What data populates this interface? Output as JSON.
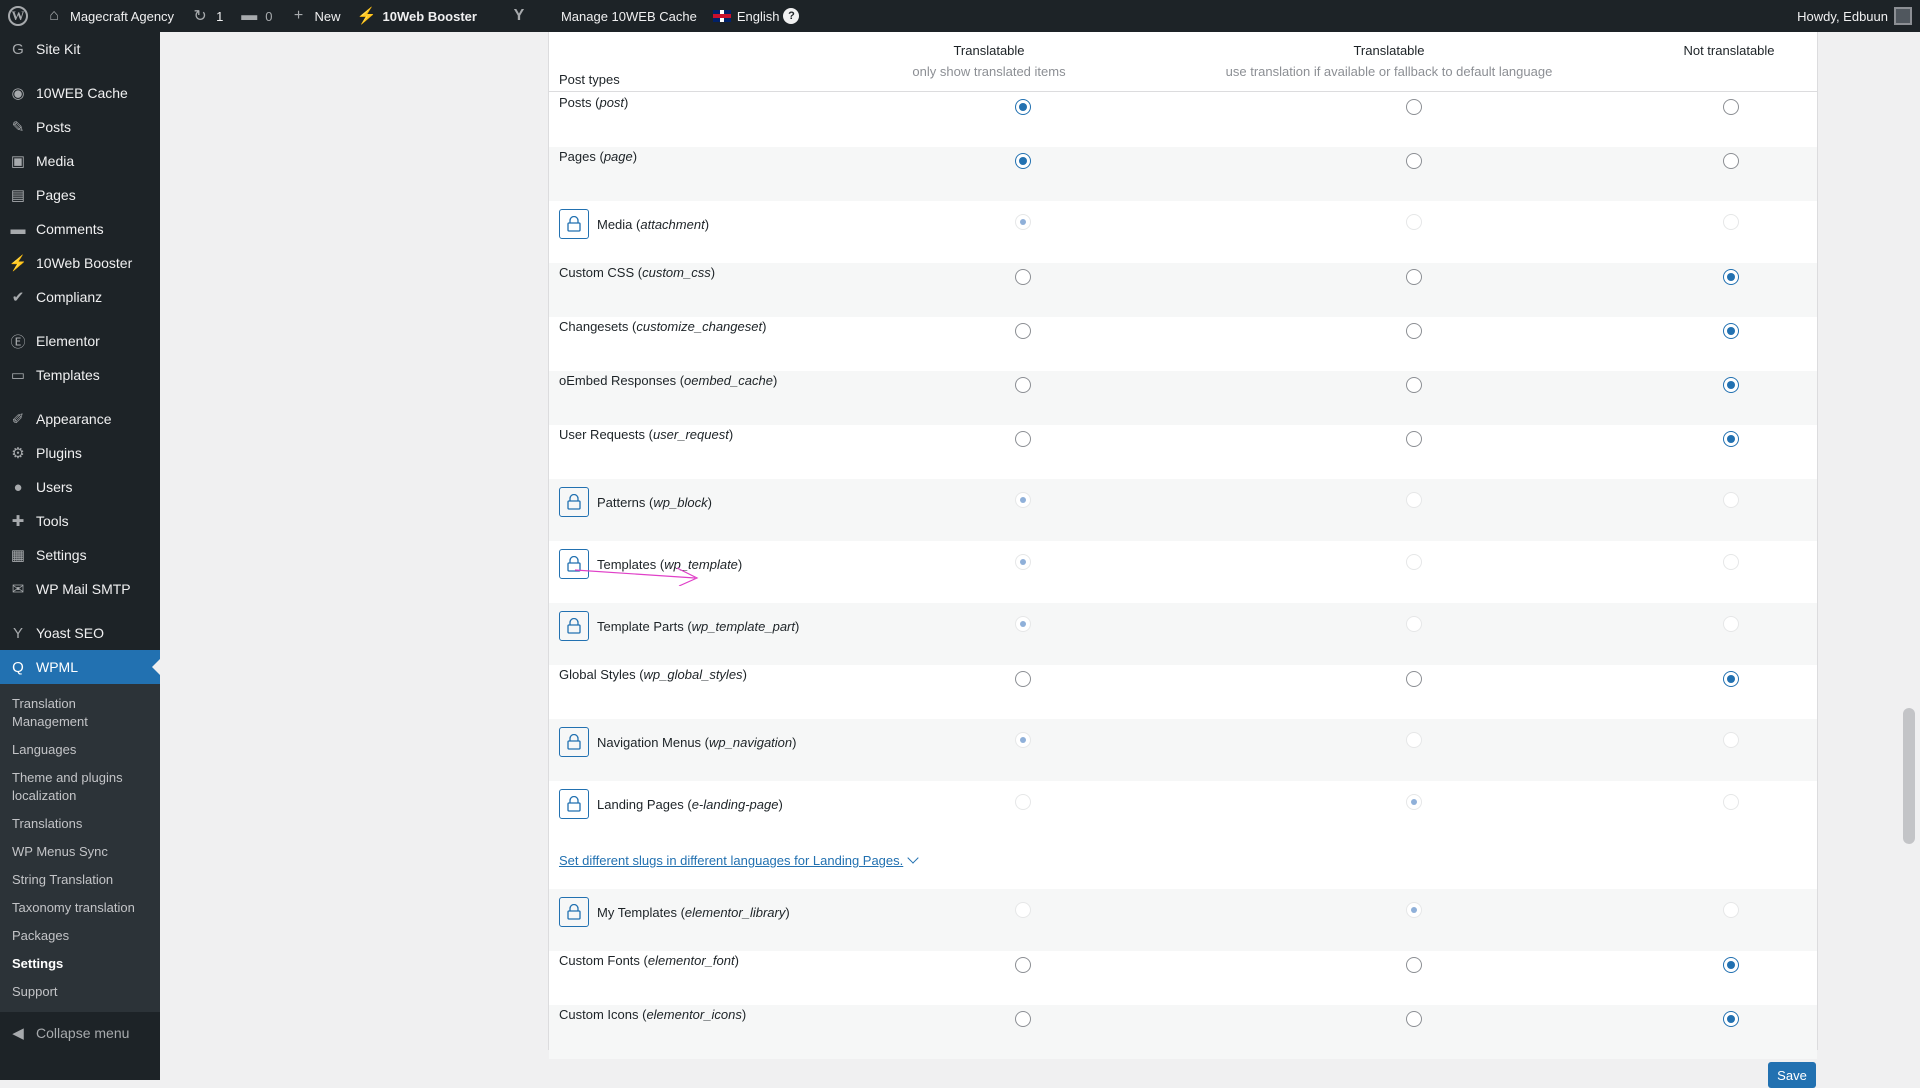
{
  "adminbar": {
    "site_name": "Magecraft Agency",
    "updates_count": "1",
    "comments_count": "0",
    "new_label": "New",
    "booster_label": "10Web Booster",
    "cache_label": "Manage 10WEB Cache",
    "language_label": "English",
    "howdy": "Howdy, Edbuun"
  },
  "sidebar": {
    "items": [
      {
        "label": "Site Kit",
        "icon": "G"
      },
      {
        "label": "10WEB Cache",
        "icon": "◉"
      },
      {
        "label": "Posts",
        "icon": "✎"
      },
      {
        "label": "Media",
        "icon": "▣"
      },
      {
        "label": "Pages",
        "icon": "▤"
      },
      {
        "label": "Comments",
        "icon": "▬"
      },
      {
        "label": "10Web Booster",
        "icon": "⚡"
      },
      {
        "label": "Complianz",
        "icon": "✔"
      },
      {
        "label": "Elementor",
        "icon": "Ⓔ"
      },
      {
        "label": "Templates",
        "icon": "▭"
      },
      {
        "label": "Appearance",
        "icon": "✐"
      },
      {
        "label": "Plugins",
        "icon": "⚙"
      },
      {
        "label": "Users",
        "icon": "●"
      },
      {
        "label": "Tools",
        "icon": "✚"
      },
      {
        "label": "Settings",
        "icon": "▦"
      },
      {
        "label": "WP Mail SMTP",
        "icon": "✉"
      },
      {
        "label": "Yoast SEO",
        "icon": "Y"
      },
      {
        "label": "WPML",
        "icon": "Q"
      }
    ],
    "submenu": [
      "Translation Management",
      "Languages",
      "Theme and plugins localization",
      "Translations",
      "WP Menus Sync",
      "String Translation",
      "Taxonomy translation",
      "Packages",
      "Settings",
      "Support"
    ],
    "collapse_label": "Collapse menu"
  },
  "table": {
    "post_types_header": "Post types",
    "col1_title": "Translatable",
    "col1_sub": "only show translated items",
    "col2_title": "Translatable",
    "col2_sub": "use translation if available or fallback to default language",
    "col3_title": "Not translatable",
    "rows": [
      {
        "name": "Posts",
        "slug": "post",
        "locked": false,
        "value": 0
      },
      {
        "name": "Pages",
        "slug": "page",
        "locked": false,
        "value": 0
      },
      {
        "name": "Media",
        "slug": "attachment",
        "locked": true,
        "value": 0
      },
      {
        "name": "Custom CSS",
        "slug": "custom_css",
        "locked": false,
        "value": 2
      },
      {
        "name": "Changesets",
        "slug": "customize_changeset",
        "locked": false,
        "value": 2
      },
      {
        "name": "oEmbed Responses",
        "slug": "oembed_cache",
        "locked": false,
        "value": 2
      },
      {
        "name": "User Requests",
        "slug": "user_request",
        "locked": false,
        "value": 2
      },
      {
        "name": "Patterns",
        "slug": "wp_block",
        "locked": true,
        "value": 0
      },
      {
        "name": "Templates",
        "slug": "wp_template",
        "locked": true,
        "value": 0
      },
      {
        "name": "Template Parts",
        "slug": "wp_template_part",
        "locked": true,
        "value": 0
      },
      {
        "name": "Global Styles",
        "slug": "wp_global_styles",
        "locked": false,
        "value": 2
      },
      {
        "name": "Navigation Menus",
        "slug": "wp_navigation",
        "locked": true,
        "value": 0
      },
      {
        "name": "Landing Pages",
        "slug": "e-landing-page",
        "locked": true,
        "value": 1
      },
      {
        "name": "My Templates",
        "slug": "elementor_library",
        "locked": true,
        "value": 1
      },
      {
        "name": "Custom Fonts",
        "slug": "elementor_font",
        "locked": false,
        "value": 2
      },
      {
        "name": "Custom Icons",
        "slug": "elementor_icons",
        "locked": false,
        "value": 2
      }
    ],
    "slug_link": "Set different slugs in different languages for Landing Pages."
  },
  "save_label": "Save",
  "colors": {
    "accent": "#2271b1",
    "sidebar": "#1d2327",
    "arrow": "#e040c8"
  }
}
